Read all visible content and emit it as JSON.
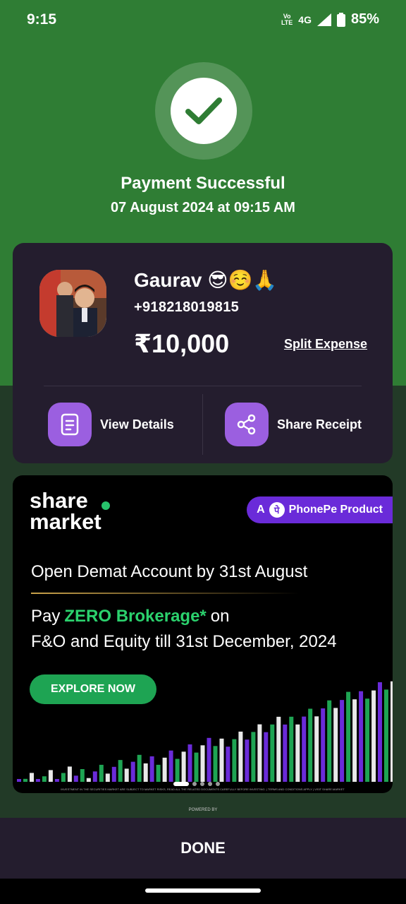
{
  "status": {
    "time": "9:15",
    "volte_top": "Vo",
    "volte_bottom": "LTE",
    "network": "4G",
    "battery": "85%"
  },
  "transaction": {
    "title": "Payment Successful",
    "datetime": "07 August 2024 at 09:15 AM"
  },
  "payee": {
    "name": "Gaurav 😎☺️🙏",
    "phone": "+918218019815",
    "amount": "₹10,000",
    "split_label": "Split Expense"
  },
  "actions": {
    "view_details": "View Details",
    "share_receipt": "Share Receipt"
  },
  "ad": {
    "brand_line1": "share",
    "brand_line2": "market",
    "pill_prefix": "A",
    "pill_label": "PhonePe Product",
    "headline": "Open Demat Account by 31st August",
    "line2_prefix": "Pay",
    "line2_highlight": "ZERO Brokerage*",
    "line2_suffix": "on",
    "line3": "F&O and Equity till 31st December, 2024",
    "cta": "EXPLORE NOW",
    "disclaimer": "INVESTMENT IN THE SECURITIES MARKET ARE SUBJECT TO MARKET RISKS, READ ALL THE RELATED DOCUMENTS CAREFULLY BEFORE INVESTING. | TERMS AND CONDITIONS APPLY | VISIT SHARE.MARKET",
    "carousel_count": 5,
    "carousel_active": 1
  },
  "footer": {
    "powered_by": "POWERED BY",
    "done": "DONE"
  },
  "colors": {
    "success_green": "#2f7d34",
    "card_bg": "#241d2e",
    "accent_purple": "#9b5fe0",
    "cta_green": "#1ea453"
  }
}
